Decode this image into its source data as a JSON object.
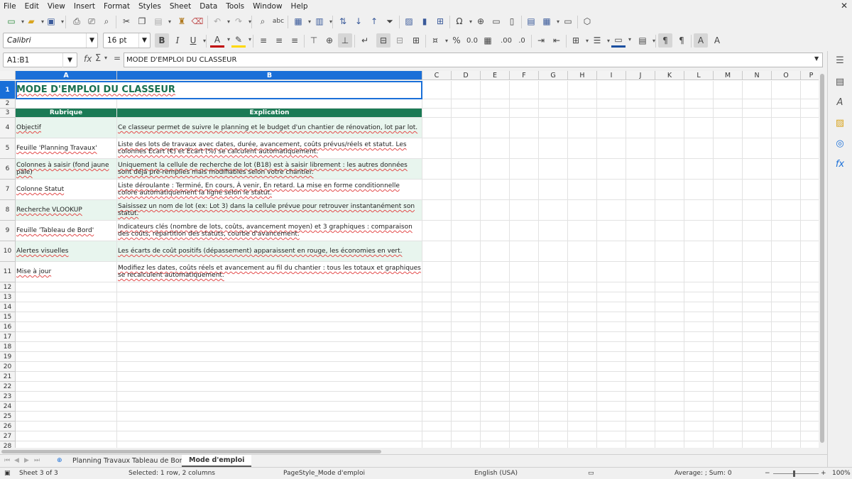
{
  "menu": [
    "File",
    "Edit",
    "View",
    "Insert",
    "Format",
    "Styles",
    "Sheet",
    "Data",
    "Tools",
    "Window",
    "Help"
  ],
  "font": {
    "name": "Calibri",
    "size": "16 pt"
  },
  "formula_bar": {
    "cell_ref": "A1:B1",
    "content": "MODE D'EMPLOI DU CLASSEUR"
  },
  "columns": [
    "A",
    "B",
    "C",
    "D",
    "E",
    "F",
    "G",
    "H",
    "I",
    "J",
    "K",
    "L",
    "M",
    "N",
    "O",
    "P"
  ],
  "rows": [
    "1",
    "2",
    "3",
    "4",
    "5",
    "6",
    "7",
    "8",
    "9",
    "10",
    "11",
    "12",
    "13",
    "14",
    "15",
    "16",
    "17",
    "18",
    "19",
    "20",
    "21",
    "22",
    "23",
    "24",
    "25",
    "26",
    "27",
    "28"
  ],
  "sheet": {
    "title": "MODE D'EMPLOI DU CLASSEUR",
    "headers": [
      "Rubrique",
      "Explication"
    ],
    "entries": [
      {
        "topic": "Objectif",
        "text": "Ce classeur permet de suivre le planning et le budget d'un chantier de rénovation, lot par lot."
      },
      {
        "topic": "Feuille 'Planning Travaux'",
        "text": "Liste des lots de travaux avec dates, durée, avancement, coûts prévus/réels et statut. Les colonnes Écart (€) et Écart (%) se calculent automatiquement."
      },
      {
        "topic": "Colonnes à saisir (fond jaune pâle)",
        "text": "Uniquement la cellule de recherche de lot (B18) est à saisir librement : les autres données sont déjà pré-remplies mais modifiables selon votre chantier."
      },
      {
        "topic": "Colonne Statut",
        "text": "Liste déroulante : Terminé, En cours, À venir, En retard. La mise en forme conditionnelle colore automatiquement la ligne selon le statut."
      },
      {
        "topic": "Recherche VLOOKUP",
        "text": "Saisissez un nom de lot (ex: Lot 3) dans la cellule prévue pour retrouver instantanément son statut."
      },
      {
        "topic": "Feuille 'Tableau de Bord'",
        "text": "Indicateurs clés (nombre de lots, coûts, avancement moyen) et 3 graphiques : comparaison des coûts, répartition des statuts, courbe d'avancement."
      },
      {
        "topic": "Alertes visuelles",
        "text": "Les écarts de coût positifs (dépassement) apparaissent en rouge, les économies en vert."
      },
      {
        "topic": "Mise à jour",
        "text": "Modifiez les dates, coûts réels et avancement au fil du chantier : tous les totaux et graphiques se recalculent automatiquement."
      }
    ]
  },
  "tabs": [
    "Planning Travaux",
    "Tableau de Bord",
    "Mode d'emploi"
  ],
  "status": {
    "sheet": "Sheet 3 of 3",
    "selection": "Selected: 1 row, 2 columns",
    "page_style": "PageStyle_Mode d'emploi",
    "language": "English (USA)",
    "sum": "Average: ; Sum: 0",
    "zoom": "100%"
  },
  "colors": {
    "header_green": "#1b7a55",
    "title_green": "#1a7050",
    "band": "#e8f5ee",
    "selection": "#1a6fd8"
  }
}
